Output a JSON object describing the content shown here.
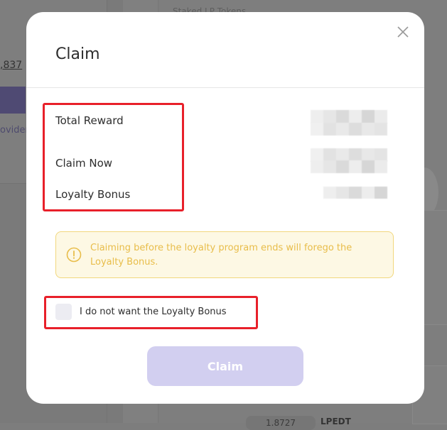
{
  "background": {
    "staked_label": "Staked LP Tokens",
    "amount_text": ",837",
    "provider_text": "ovider",
    "bottom_number": "1.8727",
    "bottom_suffix": "LPEDT"
  },
  "modal": {
    "title": "Claim",
    "close_icon": "close-icon",
    "rows": [
      {
        "label": "Total Reward"
      },
      {
        "label": "Claim Now"
      },
      {
        "label": "Loyalty Bonus"
      }
    ],
    "warning": {
      "icon": "info-icon",
      "text": "Claiming before the loyalty program ends will forego the Loyalty Bonus."
    },
    "checkbox": {
      "label": "I do not want the Loyalty Bonus",
      "checked": false
    },
    "claim_button_label": "Claim"
  },
  "colors": {
    "accent_disabled": "#d2cff0",
    "warning_bg": "#fdf8e4",
    "warning_border": "#f1d77d",
    "warning_text": "#e8bd4a",
    "highlight": "#e8202a"
  }
}
